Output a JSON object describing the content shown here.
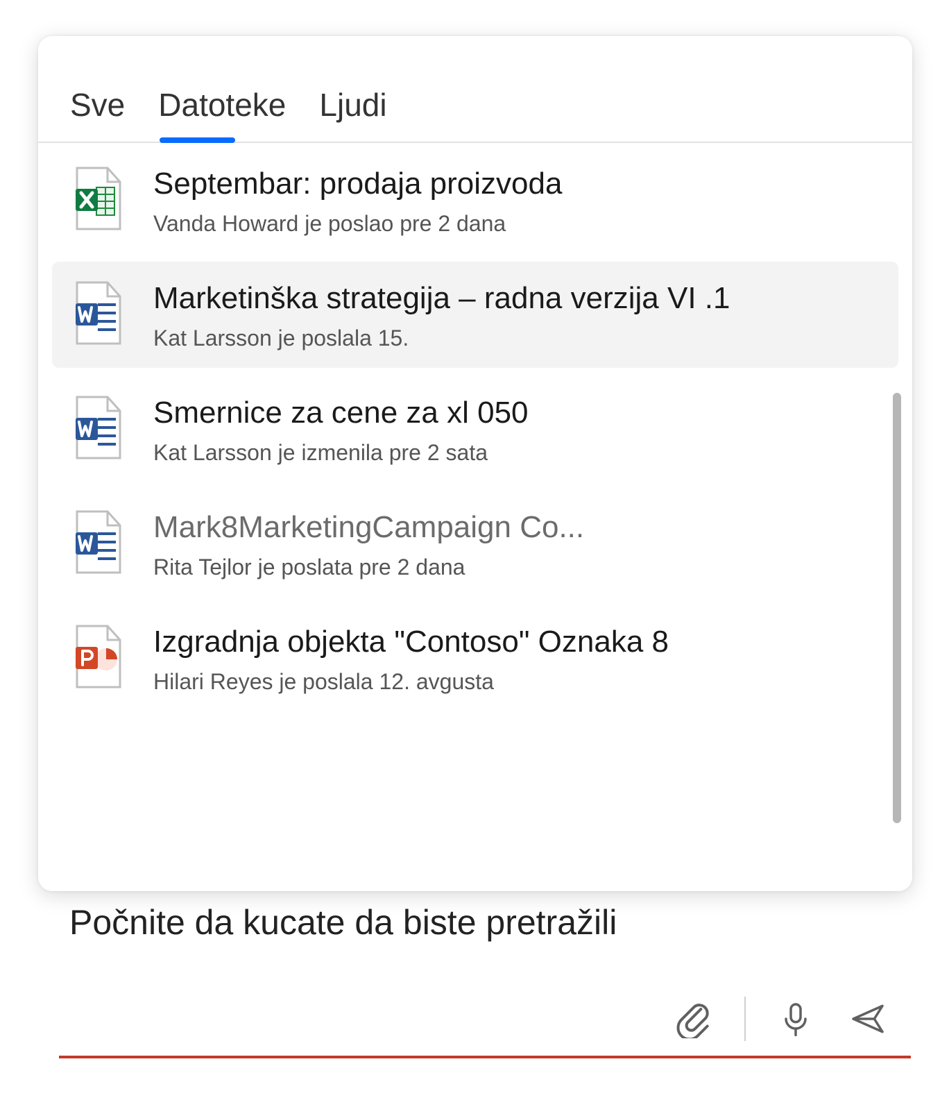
{
  "search": {
    "placeholder": "Počnite da kucate da biste pretražili"
  },
  "tabs": [
    {
      "label": "Sve",
      "active": false
    },
    {
      "label": "Datoteke",
      "active": true
    },
    {
      "label": "Ljudi",
      "active": false
    }
  ],
  "items": [
    {
      "icon": "excel",
      "title": "Septembar: prodaja proizvoda",
      "sub": "Vanda      Howard je poslao pre 2 dana",
      "selected": false,
      "dim": false
    },
    {
      "icon": "word",
      "title": "Marketinška strategija – radna verzija VI .1",
      "sub": "Kat Larsson je poslala 15.",
      "selected": true,
      "dim": false
    },
    {
      "icon": "word",
      "title": "Smernice za cene za xl 050",
      "sub": "Kat Larsson je izmenila pre 2 sata",
      "selected": false,
      "dim": false
    },
    {
      "icon": "word",
      "title": "Mark8MarketingCampaign Co...",
      "sub": "Rita Tejlor je poslata pre 2 dana",
      "selected": false,
      "dim": true
    },
    {
      "icon": "powerpoint",
      "title": "Izgradnja objekta \"Contoso\"   Oznaka 8",
      "sub": "Hilari Reyes je poslala 12. avgusta",
      "selected": false,
      "dim": false
    }
  ],
  "icons": {
    "attach": "attach-icon",
    "mic": "mic-icon",
    "send": "send-icon"
  }
}
